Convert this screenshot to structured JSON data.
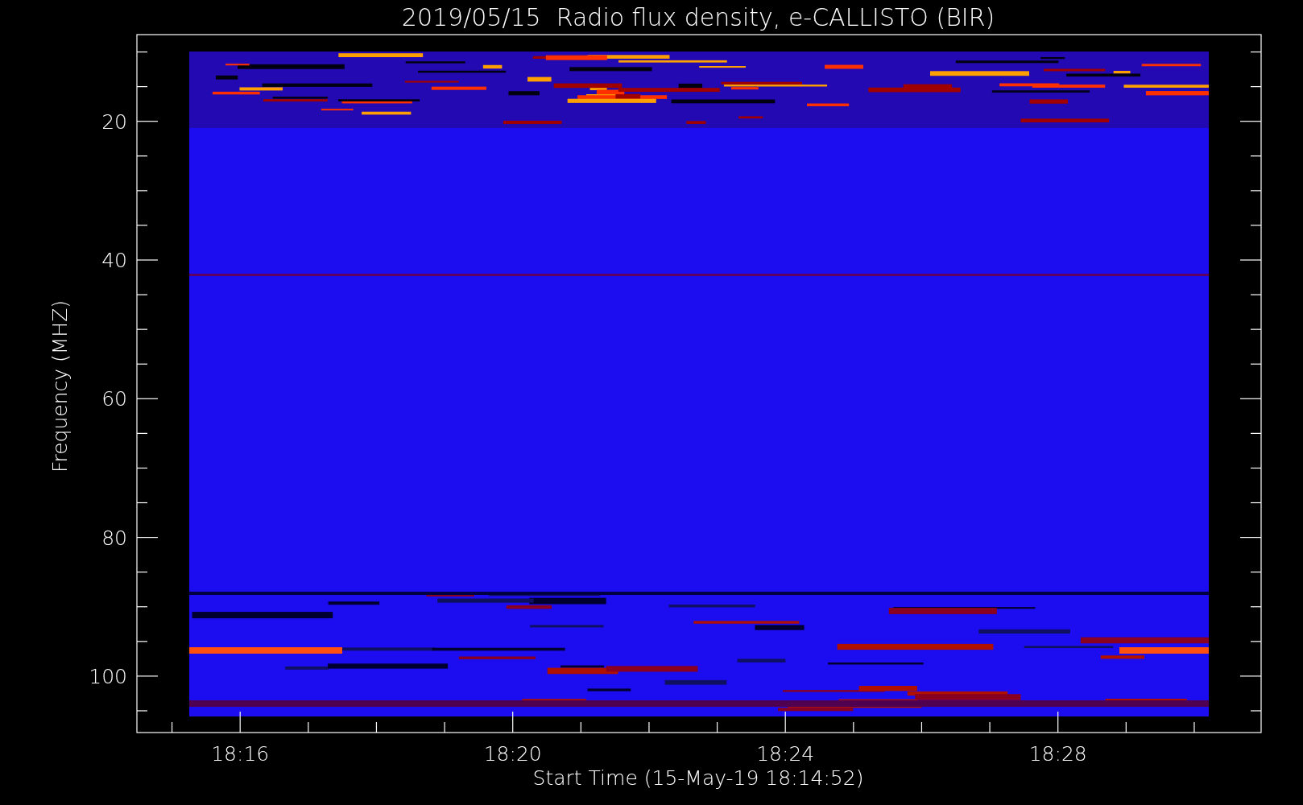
{
  "plot": {
    "title": "2019/05/15  Radio flux density, e-CALLISTO (BIR)",
    "xlabel": "Start Time (15-May-19 18:14:52)",
    "ylabel": "Frequency (MHZ)",
    "xticks": [
      "18:16",
      "18:20",
      "18:24",
      "18:28"
    ],
    "yticks": [
      "20",
      "40",
      "60",
      "80",
      "100"
    ]
  }
}
